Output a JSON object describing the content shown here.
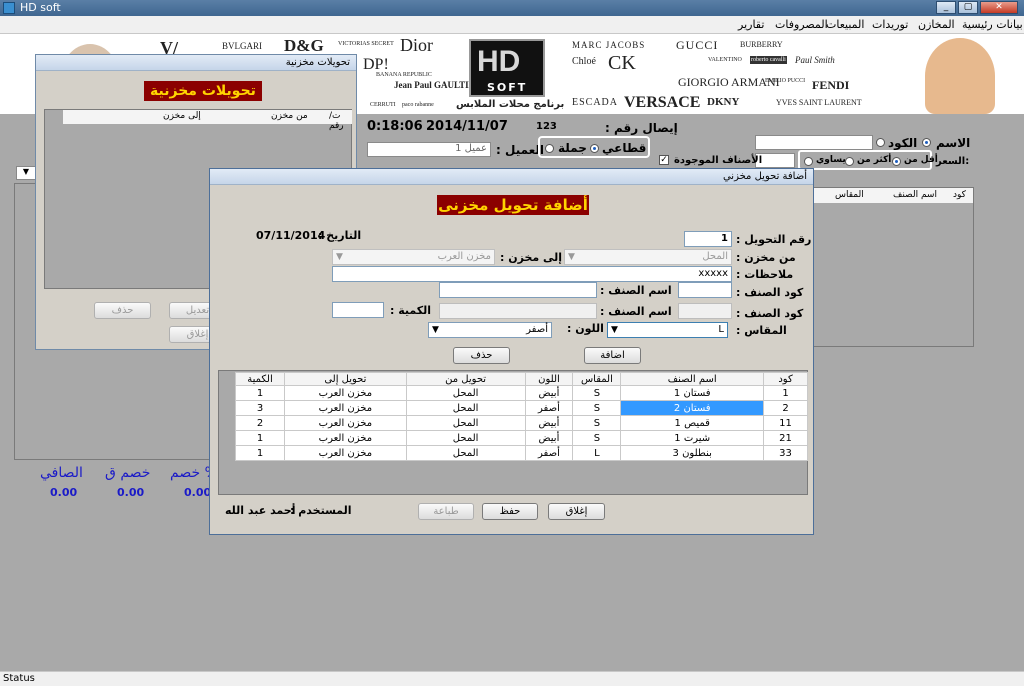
{
  "window": {
    "title": "HD soft"
  },
  "menu": [
    "بيانات رئيسية",
    "المخازن",
    "توريدات",
    "المبيعات",
    "المصروفات",
    "تقارير"
  ],
  "banner": {
    "brands": [
      "BVLGARI",
      "D&G",
      "VICTORIAS SECRET",
      "Dior",
      "DP!",
      "BANANA REPUBLIC",
      "Jean Paul GAULTIER",
      "CERRUTI",
      "paco rabanne",
      "MARC JACOBS",
      "GUCCI",
      "BURBERRY",
      "Chloé",
      "CK",
      "VALENTINO",
      "roberto cavalli",
      "Paul Smith",
      "GIORGIO ARMANI",
      "EMILIO PUCCI",
      "FENDI",
      "ESCADA",
      "VERSACE",
      "DKNY",
      "YVES SAINT LAURENT"
    ],
    "logo_text": "HD",
    "logo_sub": "SOFT",
    "tagline": "برنامج محلات الملابس"
  },
  "main": {
    "invoice_label": "إيصال رقم :",
    "invoice_no": "123",
    "time": "0:18:06",
    "date": "2014/11/07",
    "customer_label": "العميل :",
    "customer_value": "عميل 1",
    "retail": "قطاعي",
    "wholesale": "جملة",
    "name_label": "الاسم",
    "code_label": "الكود",
    "price_label": "السعر:",
    "less_than": "أقل من",
    "more_than": "أكثر من",
    "equal": "يساوي",
    "available_items": "الأصناف الموجودة",
    "grid_headers": [
      "كود",
      "اسم الصنف",
      "المقاس"
    ],
    "totals_labels": [
      "الصافي",
      "خصم ق",
      "خصم %"
    ],
    "totals_values": [
      "0.00",
      "0.00",
      "0.00"
    ]
  },
  "transfers_window": {
    "title": "تحويلات مخزنية",
    "heading": "تحويلات مخزنية",
    "headers": [
      "ت/رقم",
      "من مخزن",
      "إلى مخزن"
    ],
    "buttons": {
      "delete": "حذف",
      "edit": "تعديل",
      "close": "إغلاق"
    }
  },
  "dialog": {
    "title": "أضافة تحويل مخزني",
    "heading": "أضافة تحويل مخزنى",
    "transfer_no_label": "رقم التحويل :",
    "transfer_no": "1",
    "date_label": "التاريخ :",
    "date_value": "07/11/2014",
    "from_label": "من مخزن :",
    "from_value": "المحل",
    "to_label": "إلى مخزن :",
    "to_value": "مخزن العرب",
    "notes_label": "ملاحظات :",
    "notes_value": "xxxxx",
    "code_label": "كود الصنف :",
    "name_label": "اسم الصنف :",
    "qty_label": "الكمية :",
    "size_label": "المقاس :",
    "size_value": "L",
    "color_label": "اللون :",
    "color_value": "أصفر",
    "add_button": "اضافة",
    "delete_button": "حذف",
    "user_label": "المستخدم :",
    "user_name": "أحمد عبد الله",
    "print_button": "طباعة",
    "save_button": "حفظ",
    "close_button": "إغلاق",
    "grid_headers": [
      "كود",
      "اسم الصنف",
      "المقاس",
      "اللون",
      "تحويل من",
      "تحويل إلى",
      "الكمية"
    ],
    "rows": [
      {
        "code": "1",
        "name": "فستان 1",
        "size": "S",
        "color": "أبيض",
        "from": "المحل",
        "to": "مخزن العرب",
        "qty": "1"
      },
      {
        "code": "2",
        "name": "فستان 2",
        "size": "S",
        "color": "أصفر",
        "from": "المحل",
        "to": "مخزن العرب",
        "qty": "3"
      },
      {
        "code": "11",
        "name": "قميص 1",
        "size": "S",
        "color": "أبيض",
        "from": "المحل",
        "to": "مخزن العرب",
        "qty": "2"
      },
      {
        "code": "21",
        "name": "شيرت 1",
        "size": "S",
        "color": "أبيض",
        "from": "المحل",
        "to": "مخزن العرب",
        "qty": "1"
      },
      {
        "code": "33",
        "name": "بنطلون 3",
        "size": "L",
        "color": "أصفر",
        "from": "المحل",
        "to": "مخزن العرب",
        "qty": "1"
      }
    ]
  },
  "status": {
    "text": "Status"
  }
}
